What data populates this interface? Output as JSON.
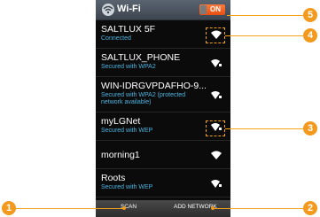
{
  "header": {
    "title": "Wi-Fi",
    "toggle_label": "ON"
  },
  "networks": [
    {
      "name": "SALTLUX 5F",
      "status": "Connected"
    },
    {
      "name": "SALTLUX_PHONE",
      "status": "Secured with WPA2"
    },
    {
      "name": "WIN-IDRGVPDAFHO-9...",
      "status": "Secured with WPA2 (protected network available)"
    },
    {
      "name": "myLGNet",
      "status": "Secured with WEP"
    },
    {
      "name": "morning1",
      "status": ""
    },
    {
      "name": "Roots",
      "status": "Secured with WEP"
    }
  ],
  "bottombar": {
    "scan_label": "SCAN",
    "add_network_label": "ADD NETWORK"
  },
  "callouts": {
    "c1": "1",
    "c2": "2",
    "c3": "3",
    "c4": "4",
    "c5": "5"
  },
  "colors": {
    "accent": "#f39a1e",
    "status_text": "#4fb3e0",
    "toggle_on": "#e84e10"
  }
}
